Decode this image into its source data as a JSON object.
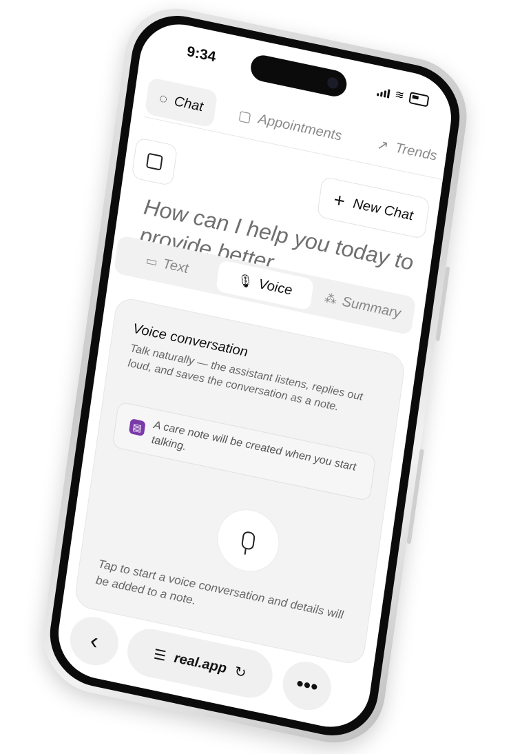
{
  "status_bar": {
    "time": "9:34"
  },
  "tabs": [
    {
      "label": "Chat",
      "active": true,
      "icon": "chat-icon"
    },
    {
      "label": "Appointments",
      "active": false,
      "icon": "calendar-icon"
    },
    {
      "label": "Trends",
      "active": false,
      "icon": "trend-icon"
    }
  ],
  "toolbar": {
    "new_chat_label": "New Chat"
  },
  "hero": {
    "text": "How can I help you today to provide better"
  },
  "modes": [
    {
      "label": "Text",
      "active": false,
      "icon": "text-icon"
    },
    {
      "label": "Voice",
      "active": true,
      "icon": "mic-icon"
    },
    {
      "label": "Summary",
      "active": false,
      "icon": "grid-icon"
    }
  ],
  "card": {
    "title": "Voice conversation",
    "description": "Talk naturally — the assistant listens, replies out loud, and saves the conversation as a note.",
    "note_text": "A care note will be created when you start talking.",
    "hint": "Tap to start a voice conversation and details will be added to a note."
  },
  "bottom_bar": {
    "address": "real.app"
  },
  "colors": {
    "accent_purple": "#7a3aa8"
  }
}
